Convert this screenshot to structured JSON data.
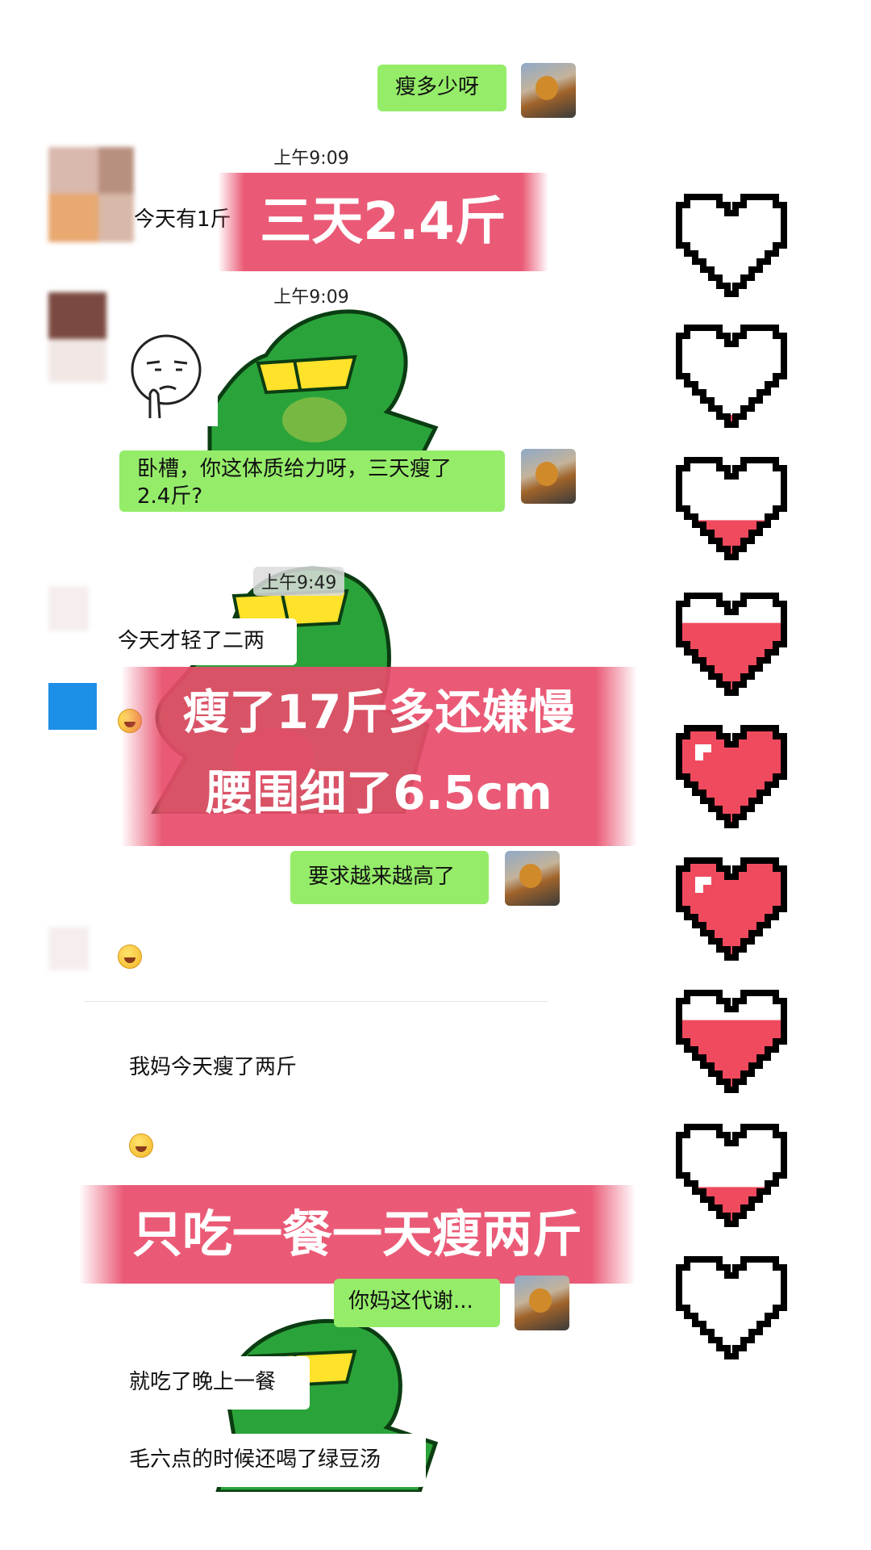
{
  "messages": {
    "m1": "瘦多少呀",
    "m2": "今天有1斤",
    "m3": "卧槽，你这体质给力呀，三天瘦了",
    "m3b": "2.4斤?",
    "m4": "今天才轻了二两",
    "m5": "要求越来越高了",
    "m6": "我妈今天瘦了两斤",
    "m7": "你妈这代谢...",
    "m8": "就吃了晚上一餐",
    "m9": "毛六点的时候还喝了绿豆汤"
  },
  "timestamps": {
    "t1": "上午9:09",
    "t2": "上午9:09",
    "t3": "上午9:49"
  },
  "banners": {
    "b1": "三天2.4斤",
    "b2": "瘦了17斤多还嫌慢",
    "b3": "腰围细了6.5cm",
    "b4": "只吃一餐一天瘦两斤"
  },
  "hearts": {
    "fill_levels": [
      0,
      0.1,
      0.38,
      0.72,
      1,
      1,
      0.72,
      0.38,
      0
    ],
    "fill_color": "#f04a5e",
    "outline_color": "#000000"
  },
  "colors": {
    "bubble_green": "#95ec69",
    "banner_pink": "#e84c6a",
    "sticker_green": "#2aa43a"
  },
  "icons": {
    "sticker": "green-crocodile-sticker",
    "thinking": "thinking-face-sticker",
    "emoji": "laughing-emoji"
  }
}
